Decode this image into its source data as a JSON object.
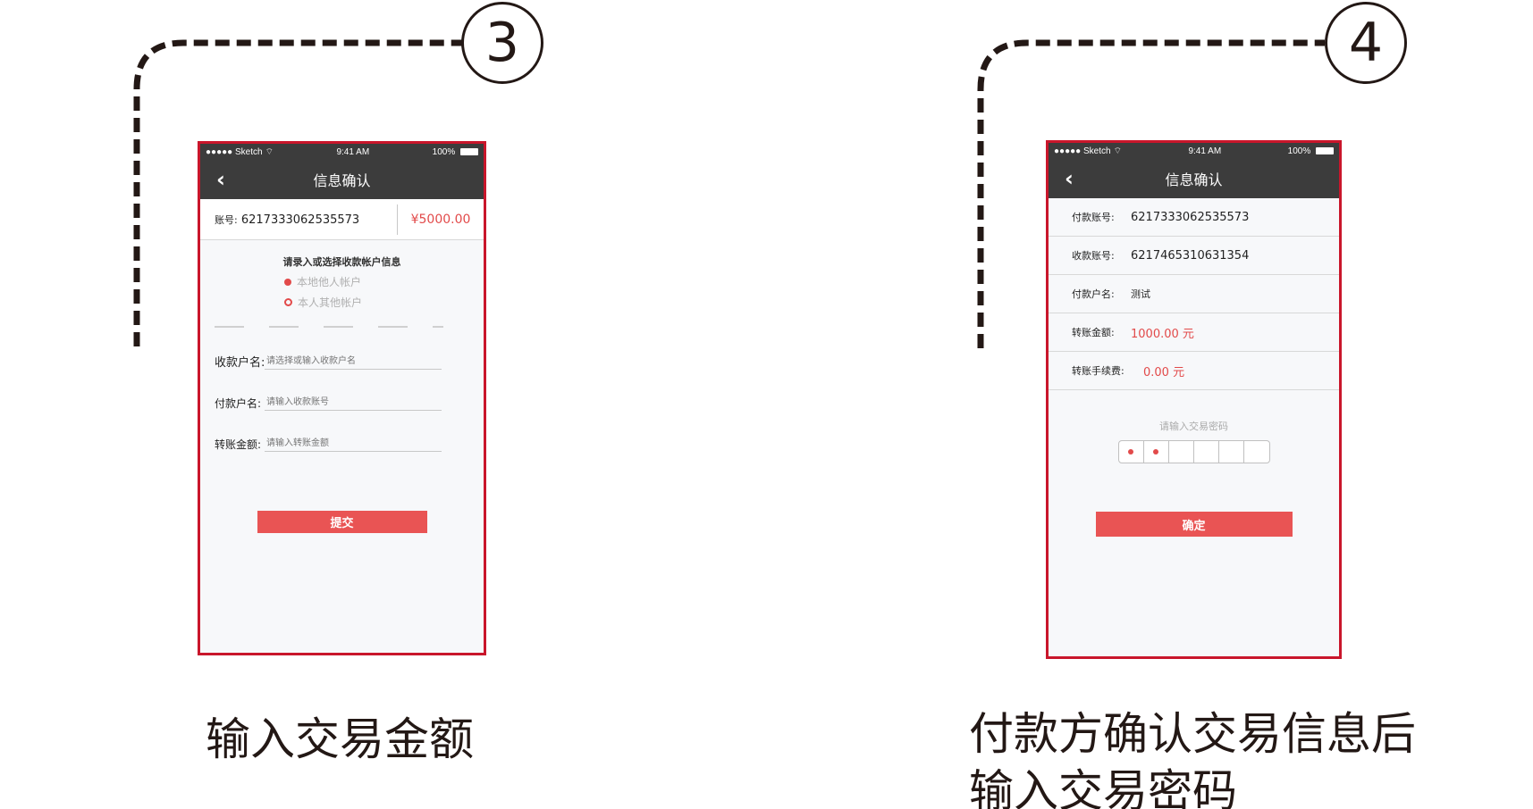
{
  "steps": [
    {
      "number": "3",
      "caption": "输入交易金额",
      "phone": {
        "status": {
          "carrier": "●●●●● Sketch",
          "wifi": "⌔",
          "time": "9:41 AM",
          "battery": "100%"
        },
        "nav_title": "信息确认",
        "back_icon": "chevron-left-icon",
        "account_label": "账号:",
        "account_number": "6217333062535573",
        "amount": "¥5000.00",
        "select_title": "请录入或选择收款帐户信息",
        "options": [
          "本地他人帐户",
          "本人其他帐户"
        ],
        "fields": [
          {
            "label": "收款户名:",
            "placeholder": "请选择或输入收款户名"
          },
          {
            "label": "付款户名:",
            "placeholder": "请输入收款账号"
          },
          {
            "label": "转账金额:",
            "placeholder": "请输入转账金额"
          }
        ],
        "submit_label": "提交"
      }
    },
    {
      "number": "4",
      "caption_lines": [
        "付款方确认交易信息后",
        "输入交易密码"
      ],
      "phone": {
        "status": {
          "carrier": "●●●●● Sketch",
          "wifi": "⌔",
          "time": "9:41 AM",
          "battery": "100%"
        },
        "nav_title": "信息确认",
        "back_icon": "chevron-left-icon",
        "rows": [
          {
            "label": "付款账号:",
            "value": "6217333062535573"
          },
          {
            "label": "收款账号:",
            "value": "6217465310631354"
          },
          {
            "label": "付款户名:",
            "value": "测试"
          },
          {
            "label": "转账金额:",
            "value": "1000.00 元"
          },
          {
            "label": "转账手续费:",
            "value": "0.00 元"
          }
        ],
        "password_prompt": "请输入交易密码",
        "password_digits_entered": 2,
        "password_length": 6,
        "confirm_label": "确定"
      }
    }
  ],
  "colors": {
    "accent": "#e95454",
    "frame": "#c9162b",
    "navbar": "#3c3c3c",
    "connector": "#231815"
  }
}
